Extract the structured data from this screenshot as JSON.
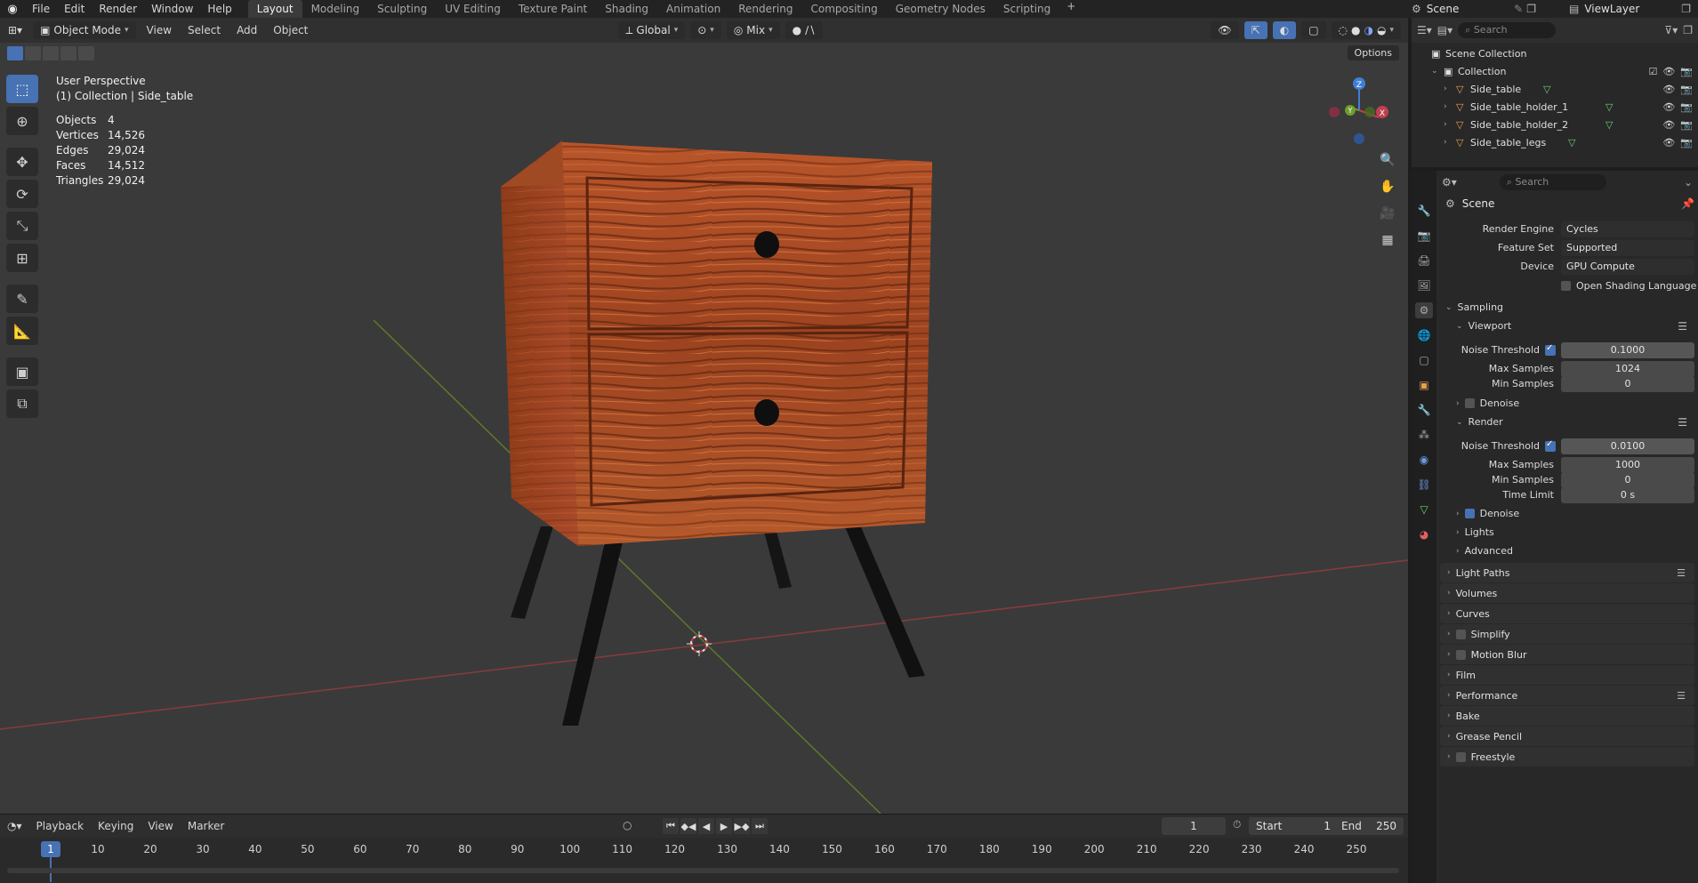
{
  "topbar": {
    "menus": [
      "File",
      "Edit",
      "Render",
      "Window",
      "Help"
    ],
    "workspaces": [
      "Layout",
      "Modeling",
      "Sculpting",
      "UV Editing",
      "Texture Paint",
      "Shading",
      "Animation",
      "Rendering",
      "Compositing",
      "Geometry Nodes",
      "Scripting"
    ],
    "active_workspace": "Layout",
    "scene": "Scene",
    "view_layer": "ViewLayer"
  },
  "viewport": {
    "mode": "Object Mode",
    "menus": [
      "View",
      "Select",
      "Add",
      "Object"
    ],
    "orientation": "Global",
    "snap_mode": "Mix",
    "options": "Options",
    "perspective": "User Perspective",
    "collection_info": "(1) Collection | Side_table",
    "stats": [
      {
        "label": "Objects",
        "value": "4"
      },
      {
        "label": "Vertices",
        "value": "14,526"
      },
      {
        "label": "Edges",
        "value": "29,024"
      },
      {
        "label": "Faces",
        "value": "14,512"
      },
      {
        "label": "Triangles",
        "value": "29,024"
      }
    ],
    "gizmo_axes": {
      "x": "X",
      "y": "Y",
      "z": "Z"
    },
    "colors": {
      "x_axis": "#c04050",
      "y_axis": "#6e9e2e",
      "z_axis": "#3f7fd6",
      "accent": "#4772b3"
    }
  },
  "timeline": {
    "menus": [
      "Playback",
      "Keying",
      "View",
      "Marker"
    ],
    "current_frame": "1",
    "start_label": "Start",
    "start": "1",
    "end_label": "End",
    "end": "250",
    "ticks": [
      "1",
      "10",
      "20",
      "30",
      "40",
      "50",
      "60",
      "70",
      "80",
      "90",
      "100",
      "110",
      "120",
      "130",
      "140",
      "150",
      "160",
      "170",
      "180",
      "190",
      "200",
      "210",
      "220",
      "230",
      "240",
      "250"
    ]
  },
  "outliner": {
    "search_placeholder": "Search",
    "scene_collection": "Scene Collection",
    "collection": "Collection",
    "objects": [
      "Side_table",
      "Side_table_holder_1",
      "Side_table_holder_2",
      "Side_table_legs"
    ]
  },
  "properties": {
    "search_placeholder": "Search",
    "context": "Scene",
    "render_engine_label": "Render Engine",
    "render_engine": "Cycles",
    "feature_set_label": "Feature Set",
    "feature_set": "Supported",
    "device_label": "Device",
    "device": "GPU Compute",
    "osl_label": "Open Shading Language",
    "sampling": "Sampling",
    "viewport": {
      "title": "Viewport",
      "noise_threshold_label": "Noise Threshold",
      "noise_threshold": "0.1000",
      "max_samples_label": "Max Samples",
      "max_samples": "1024",
      "min_samples_label": "Min Samples",
      "min_samples": "0",
      "denoise_label": "Denoise"
    },
    "render": {
      "title": "Render",
      "noise_threshold_label": "Noise Threshold",
      "noise_threshold": "0.0100",
      "max_samples_label": "Max Samples",
      "max_samples": "1000",
      "min_samples_label": "Min Samples",
      "min_samples": "0",
      "time_limit_label": "Time Limit",
      "time_limit": "0 s",
      "denoise_label": "Denoise",
      "lights_label": "Lights",
      "advanced_label": "Advanced"
    },
    "panels": [
      "Light Paths",
      "Volumes",
      "Curves",
      "Simplify",
      "Motion Blur",
      "Film",
      "Performance",
      "Bake",
      "Grease Pencil",
      "Freestyle"
    ]
  }
}
